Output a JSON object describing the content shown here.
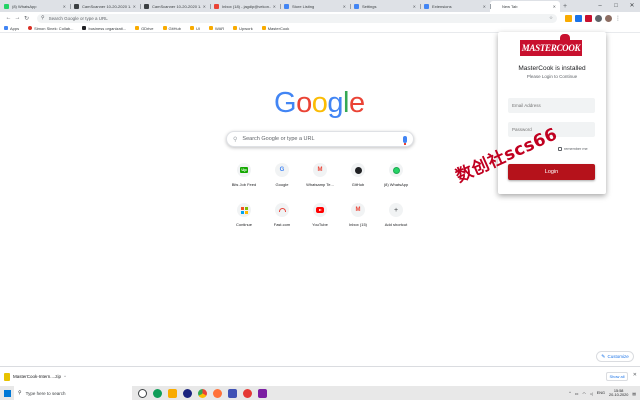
{
  "browser": {
    "tabs": [
      {
        "label": "(8) WhatsApp",
        "color": "#25d366"
      },
      {
        "label": "CamScanner 10-20-2020 1...",
        "color": "#3c4043"
      },
      {
        "label": "CamScanner 10-20-2020 1...",
        "color": "#3c4043"
      },
      {
        "label": "Inbox (18) - jagdip@vekon...",
        "color": "#ea4335"
      },
      {
        "label": "Store Listing",
        "color": "#4285f4"
      },
      {
        "label": "Settings",
        "color": "#4285f4"
      },
      {
        "label": "Extensions",
        "color": "#4285f4"
      },
      {
        "label": "New Tab",
        "color": "#ffffff",
        "active": true
      }
    ],
    "omnibox_placeholder": "Search Google or type a URL",
    "bookmarks": [
      {
        "label": "Apps",
        "icon": "apps-grid-icon"
      },
      {
        "label": "Simon Sinek: Collab...",
        "icon": "red-dot-icon"
      },
      {
        "label": "business organizati...",
        "icon": "dark-square-icon"
      },
      {
        "label": "GDrive",
        "icon": "folder-icon"
      },
      {
        "label": "GitHub",
        "icon": "folder-icon"
      },
      {
        "label": "UI",
        "icon": "folder-icon"
      },
      {
        "label": "WAR",
        "icon": "folder-icon"
      },
      {
        "label": "Upwork",
        "icon": "folder-icon"
      },
      {
        "label": "MasterCook",
        "icon": "folder-icon"
      }
    ]
  },
  "newtab": {
    "search_placeholder": "Search Google or type a URL",
    "shortcuts": [
      {
        "label": "Bits Job Feed",
        "icon": "upwork-icon"
      },
      {
        "label": "Google",
        "icon": "google-icon"
      },
      {
        "label": "Whatsamp Te...",
        "icon": "gmail-icon"
      },
      {
        "label": "GitHub",
        "icon": "github-icon"
      },
      {
        "label": "(8) WhatsApp",
        "icon": "whatsapp-icon"
      },
      {
        "label": "Continue",
        "icon": "microsoft-icon"
      },
      {
        "label": "Fast.com",
        "icon": "speedometer-icon"
      },
      {
        "label": "YouTube",
        "icon": "youtube-icon"
      },
      {
        "label": "Inbox (15)",
        "icon": "gmail-icon"
      },
      {
        "label": "Add shortcut",
        "icon": "plus-icon"
      }
    ],
    "customize_label": "Customize"
  },
  "popup": {
    "logo_text": "MASTERCOOK",
    "title": "MasterCook is installed",
    "subtitle": "Please Login to Continue",
    "email_placeholder": "Email Address",
    "password_placeholder": "Password",
    "remember_label": "remember me",
    "login_label": "Login",
    "accent_color": "#b5121b"
  },
  "watermark": "数创社scs66",
  "downloads": {
    "file_label": "MasterCook-Intern....zip",
    "show_all_label": "Show all"
  },
  "taskbar": {
    "search_placeholder": "Type here to search",
    "language": "ENG",
    "time": "15:58",
    "date": "20-10-2020"
  }
}
